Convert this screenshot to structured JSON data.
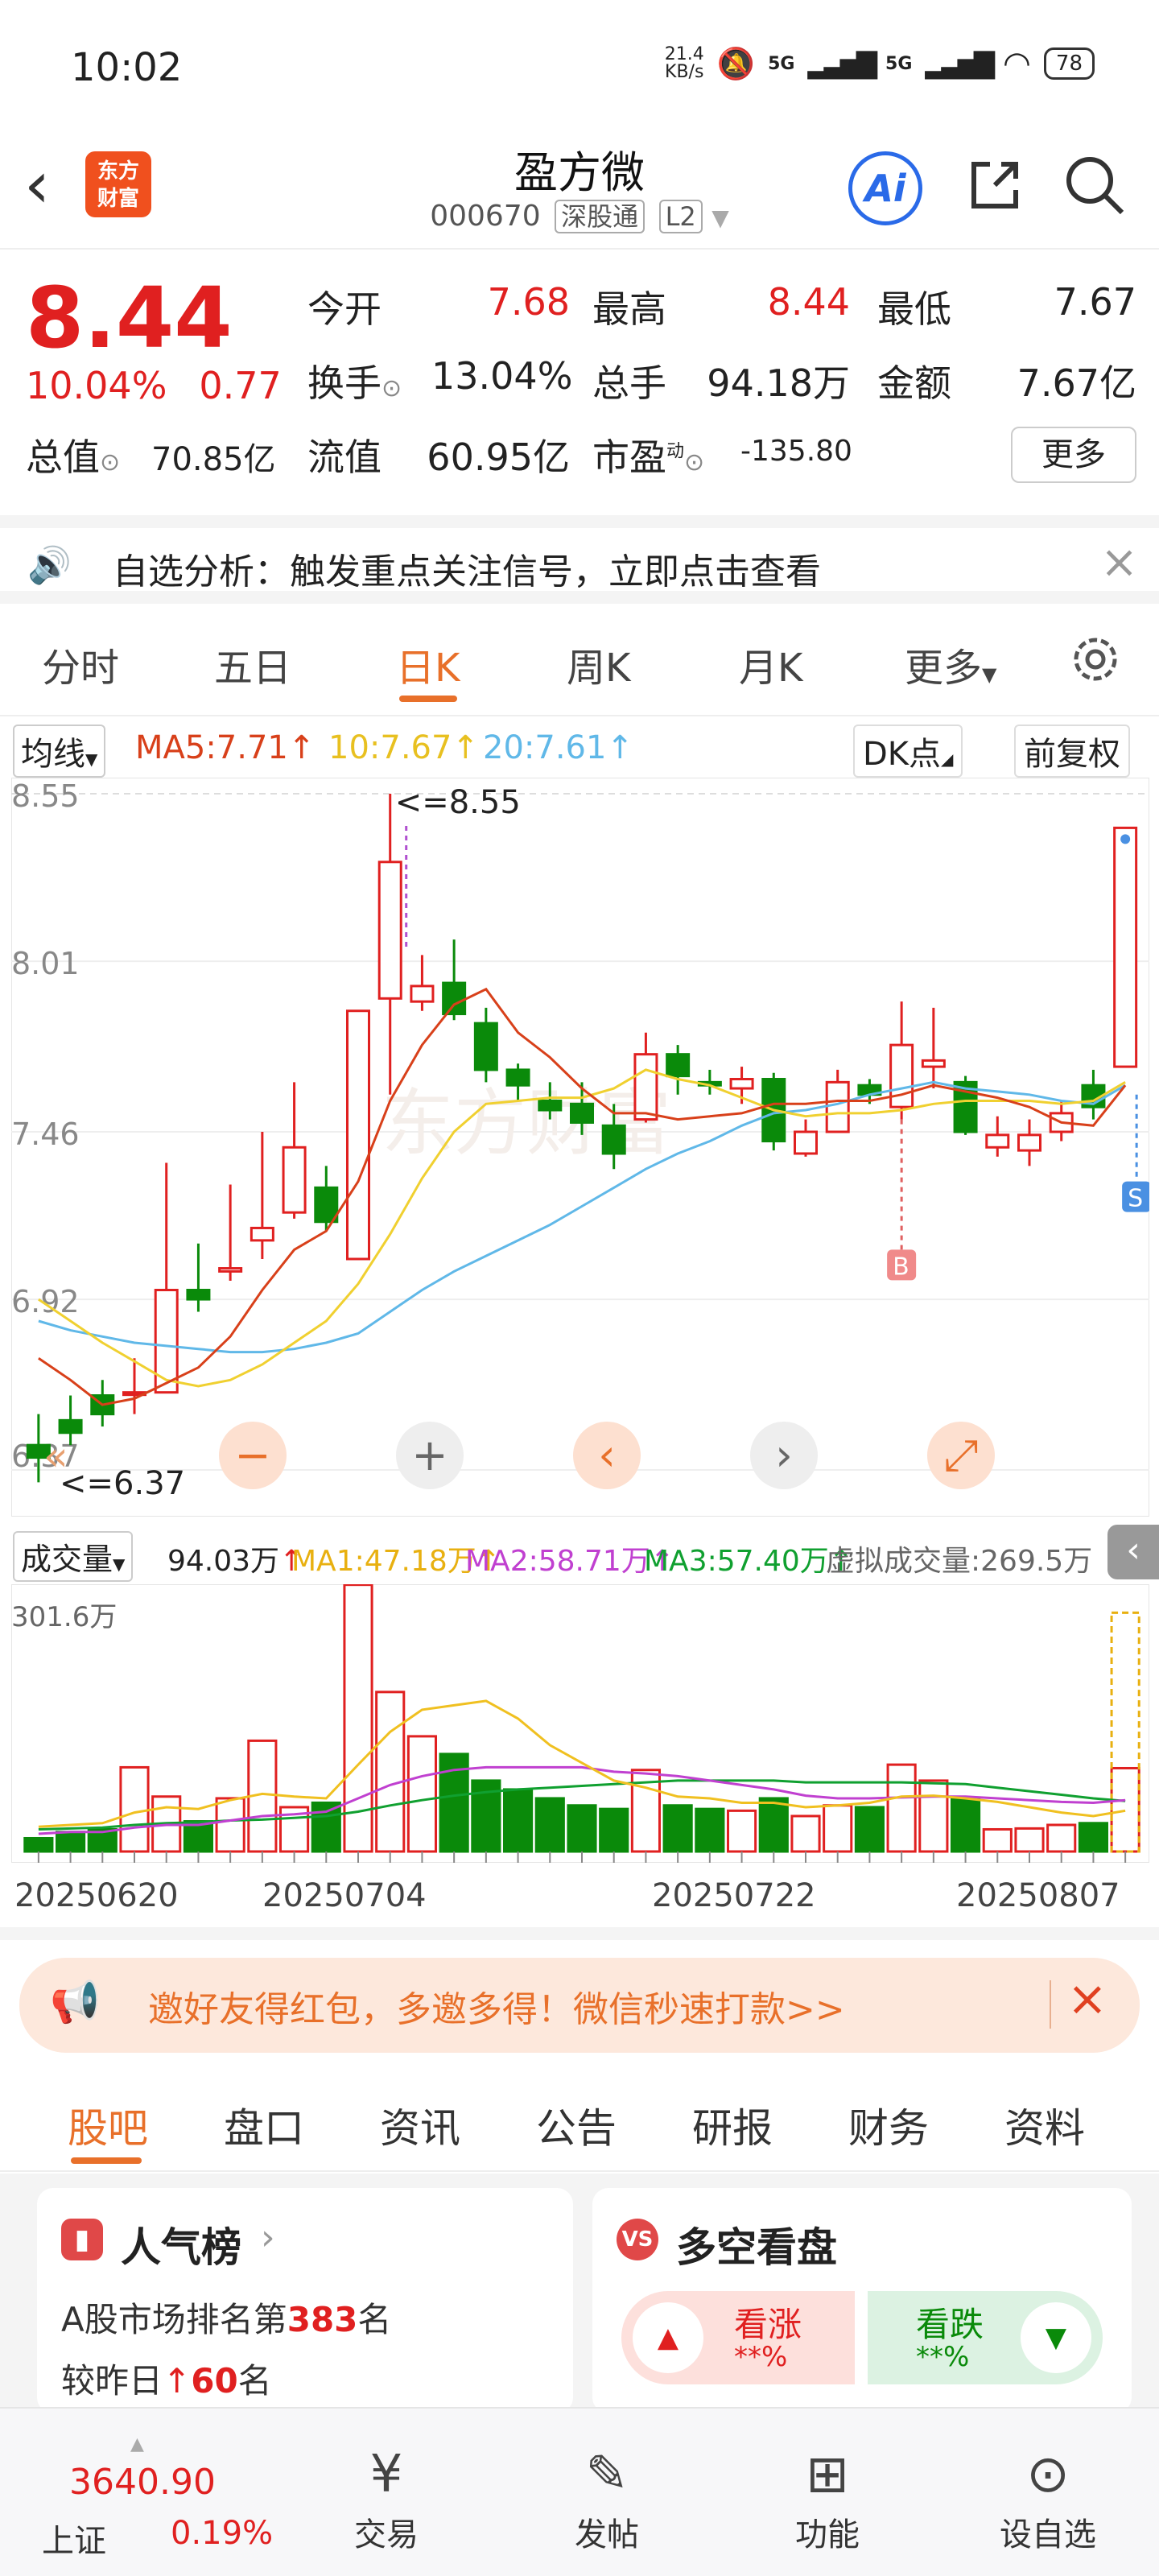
{
  "status": {
    "time": "10:02",
    "net_speed": "21.4\nKB/s",
    "signal1": "5G",
    "signal2": "5G",
    "battery": "78"
  },
  "header": {
    "logo": "东方\n财富",
    "title": "盈方微",
    "code": "000670",
    "tag1": "深股通",
    "tag2": "L2"
  },
  "quote": {
    "price": "8.44",
    "change_pct": "10.04%",
    "change": "0.77",
    "open_label": "今开",
    "open": "7.68",
    "high_label": "最高",
    "high": "8.44",
    "low_label": "最低",
    "low": "7.67",
    "turnover_label": "换手",
    "turnover": "13.04%",
    "volume_label": "总手",
    "volume": "94.18万",
    "amount_label": "金额",
    "amount": "7.67亿",
    "mcap_label": "总值",
    "mcap": "70.85亿",
    "float_label": "流值",
    "float": "60.95亿",
    "pe_label": "市盈",
    "pe_sup": "动",
    "pe": "-135.80",
    "more": "更多"
  },
  "banner": {
    "text": "自选分析：触发重点关注信号，立即点击查看"
  },
  "period_tabs": [
    "分时",
    "五日",
    "日K",
    "周K",
    "月K",
    "更多"
  ],
  "ma_legend": {
    "selector": "均线",
    "ma5": "MA5:7.71",
    "ma10": "10:7.67",
    "ma20": "20:7.61",
    "dk": "DK点",
    "adjust": "前复权"
  },
  "vol_legend": {
    "selector": "成交量",
    "vol": "94.03万",
    "ma1": "MA1:47.18万",
    "ma2": "MA2:58.71万",
    "ma3": "MA3:57.40万",
    "virtual": "虚拟成交量:269.5万"
  },
  "colors": {
    "up": "#e02020",
    "down": "#0a8a0a",
    "accent": "#e8702a",
    "ma5": "#d8401a",
    "ma10": "#f0d030",
    "ma20": "#60b8e8",
    "vma1": "#f0c020",
    "vma2": "#c040d0",
    "vma3": "#10a030"
  },
  "chart_data": {
    "type": "candlestick",
    "y_ticks": [
      "8.55",
      "8.01",
      "7.46",
      "6.92",
      "6.37"
    ],
    "ylim": [
      6.37,
      8.55
    ],
    "high_marker": "<=8.55",
    "low_marker": "<=6.37",
    "buy_marker": "B",
    "sell_marker": "S",
    "x_labels": [
      "20250620",
      "20250704",
      "20250722",
      "20250807"
    ],
    "candles": [
      [
        6.45,
        6.41,
        6.33,
        6.55
      ],
      [
        6.53,
        6.49,
        6.45,
        6.61
      ],
      [
        6.61,
        6.55,
        6.51,
        6.66
      ],
      [
        6.62,
        6.62,
        6.55,
        6.73
      ],
      [
        6.62,
        6.95,
        6.62,
        7.36
      ],
      [
        6.95,
        6.92,
        6.88,
        7.1
      ],
      [
        7.01,
        7.02,
        6.98,
        7.29
      ],
      [
        7.11,
        7.15,
        7.05,
        7.46
      ],
      [
        7.2,
        7.41,
        7.18,
        7.62
      ],
      [
        7.28,
        7.17,
        7.14,
        7.35
      ],
      [
        7.05,
        7.85,
        7.05,
        7.85
      ],
      [
        7.89,
        8.33,
        7.58,
        8.55
      ],
      [
        7.88,
        7.93,
        7.85,
        8.03
      ],
      [
        7.94,
        7.84,
        7.82,
        8.08
      ],
      [
        7.81,
        7.66,
        7.62,
        7.86
      ],
      [
        7.66,
        7.61,
        7.56,
        7.68
      ],
      [
        7.56,
        7.53,
        7.5,
        7.62
      ],
      [
        7.55,
        7.49,
        7.45,
        7.62
      ],
      [
        7.48,
        7.39,
        7.34,
        7.55
      ],
      [
        7.5,
        7.71,
        7.49,
        7.78
      ],
      [
        7.71,
        7.64,
        7.58,
        7.74
      ],
      [
        7.62,
        7.61,
        7.58,
        7.66
      ],
      [
        7.6,
        7.63,
        7.55,
        7.67
      ],
      [
        7.63,
        7.43,
        7.4,
        7.65
      ],
      [
        7.39,
        7.46,
        7.38,
        7.5
      ],
      [
        7.46,
        7.62,
        7.46,
        7.66
      ],
      [
        7.61,
        7.58,
        7.55,
        7.63
      ],
      [
        7.54,
        7.74,
        7.5,
        7.88
      ],
      [
        7.67,
        7.69,
        7.6,
        7.86
      ],
      [
        7.62,
        7.46,
        7.45,
        7.64
      ],
      [
        7.41,
        7.45,
        7.38,
        7.51
      ],
      [
        7.4,
        7.45,
        7.35,
        7.5
      ],
      [
        7.46,
        7.52,
        7.43,
        7.56
      ],
      [
        7.61,
        7.54,
        7.5,
        7.66
      ],
      [
        7.67,
        8.44,
        7.67,
        8.44
      ]
    ],
    "ma5": [
      6.73,
      6.66,
      6.58,
      6.6,
      6.65,
      6.7,
      6.8,
      6.95,
      7.08,
      7.14,
      7.3,
      7.56,
      7.74,
      7.87,
      7.92,
      7.78,
      7.7,
      7.6,
      7.52,
      7.52,
      7.5,
      7.51,
      7.52,
      7.55,
      7.55,
      7.56,
      7.56,
      7.58,
      7.61,
      7.59,
      7.57,
      7.54,
      7.49,
      7.48,
      7.61
    ],
    "ma10": [
      6.92,
      6.85,
      6.78,
      6.72,
      6.66,
      6.64,
      6.66,
      6.71,
      6.78,
      6.85,
      6.97,
      7.13,
      7.31,
      7.46,
      7.55,
      7.56,
      7.57,
      7.57,
      7.6,
      7.66,
      7.63,
      7.61,
      7.57,
      7.53,
      7.51,
      7.52,
      7.52,
      7.53,
      7.55,
      7.56,
      7.56,
      7.56,
      7.55,
      7.56,
      7.62
    ],
    "ma20": [
      6.85,
      6.82,
      6.8,
      6.78,
      6.77,
      6.76,
      6.75,
      6.75,
      6.76,
      6.78,
      6.81,
      6.88,
      6.95,
      7.01,
      7.06,
      7.11,
      7.16,
      7.22,
      7.28,
      7.34,
      7.39,
      7.43,
      7.48,
      7.52,
      7.53,
      7.55,
      7.58,
      7.6,
      7.62,
      7.6,
      7.59,
      7.58,
      7.56,
      7.55,
      7.61
    ]
  },
  "vol_data": {
    "y_top": "301.6万",
    "max": 301.6,
    "values": [
      15,
      22,
      25,
      95,
      62,
      34,
      60,
      125,
      50,
      55,
      301,
      180,
      130,
      110,
      80,
      70,
      60,
      52,
      48,
      92,
      52,
      48,
      46,
      60,
      40,
      52,
      50,
      98,
      80,
      60,
      25,
      26,
      30,
      32,
      94.03
    ],
    "virtual": 269.5,
    "ma1": [
      28,
      30,
      32,
      44,
      50,
      48,
      58,
      65,
      62,
      60,
      98,
      135,
      160,
      165,
      170,
      150,
      120,
      100,
      80,
      72,
      62,
      60,
      55,
      55,
      50,
      52,
      55,
      62,
      63,
      60,
      56,
      50,
      44,
      40,
      46
    ],
    "ma2": [
      20,
      22,
      22,
      27,
      30,
      30,
      35,
      40,
      42,
      45,
      60,
      75,
      85,
      92,
      95,
      95,
      95,
      95,
      90,
      88,
      85,
      80,
      75,
      70,
      63,
      60,
      60,
      61,
      62,
      62,
      60,
      58,
      56,
      55,
      58
    ],
    "ma3": [
      25,
      26,
      27,
      30,
      32,
      33,
      35,
      36,
      38,
      40,
      45,
      52,
      58,
      63,
      67,
      70,
      72,
      74,
      76,
      78,
      80,
      80,
      80,
      80,
      78,
      78,
      78,
      78,
      77,
      76,
      72,
      68,
      64,
      60,
      57
    ]
  },
  "promo": {
    "text": "邀好友得红包，多邀多得！微信秒速打款>>"
  },
  "sub_tabs": [
    "股吧",
    "盘口",
    "资讯",
    "公告",
    "研报",
    "财务",
    "资料"
  ],
  "popularity": {
    "title": "人气榜",
    "rank_prefix": "A股市场排名第",
    "rank": "383",
    "rank_suffix": "名",
    "delta_prefix": "较昨日",
    "delta": "60",
    "delta_suffix": "名"
  },
  "bullbear": {
    "title": "多空看盘",
    "up_label": "看涨",
    "up_val": "**%",
    "down_label": "看跌",
    "down_val": "**%"
  },
  "bottom_nav": {
    "index_value": "3640.90",
    "index_name": "上证",
    "index_pct": "0.19%",
    "trade": "交易",
    "post": "发帖",
    "func": "功能",
    "watch": "设自选"
  }
}
